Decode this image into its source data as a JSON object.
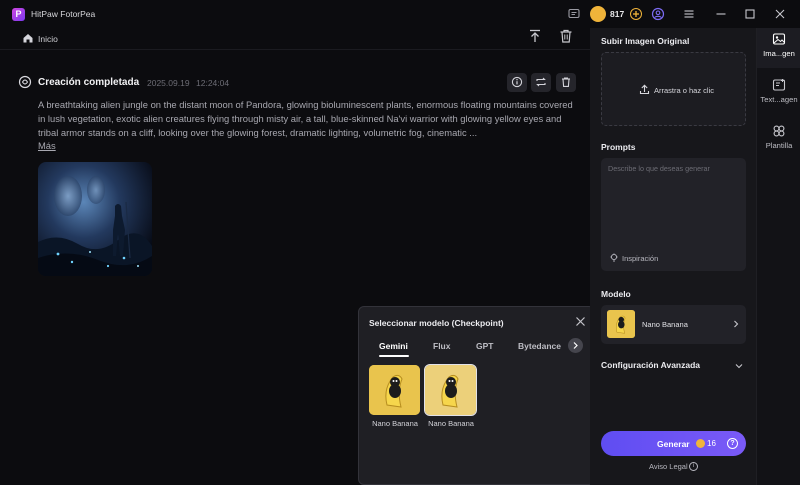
{
  "app": {
    "title": "HitPaw FotorPea",
    "coins": "817"
  },
  "header": {
    "home_label": "Inicio"
  },
  "task": {
    "title": "Creación completada",
    "date": "2025.09.19",
    "time": "12:24:04",
    "prompt": "A breathtaking alien jungle on the distant moon of Pandora, glowing bioluminescent plants, enormous floating mountains covered in lush vegetation, exotic alien creatures flying through misty air, a tall, blue-skinned Na'vi warrior with glowing yellow eyes and tribal armor stands on a cliff, looking over the glowing forest, dramatic lighting, volumetric fog, cinematic ...",
    "more_label": "Más"
  },
  "model_popup": {
    "title": "Seleccionar modelo (Checkpoint)",
    "tabs": [
      "Gemini",
      "Flux",
      "GPT",
      "Bytedance"
    ],
    "active_tab": "Gemini",
    "models": [
      {
        "name": "Nano Banana",
        "selected": false
      },
      {
        "name": "Nano Banana",
        "selected": true
      }
    ]
  },
  "right_panel": {
    "upload_title": "Subir Imagen Original",
    "upload_cta": "Arrastra o haz clic",
    "prompts_title": "Prompts",
    "prompt_placeholder": "Describe lo que deseas generar",
    "inspiration_label": "Inspiración",
    "model_title": "Modelo",
    "model_selected": "Nano Banana",
    "advanced_title": "Configuración Avanzada",
    "generate_label": "Generar",
    "generate_cost": "16",
    "legal_label": "Aviso Legal"
  },
  "side_nav": [
    {
      "label": "Ima...gen",
      "icon": "image-icon",
      "active": true
    },
    {
      "label": "Text...agen",
      "icon": "text-to-image-icon",
      "active": false
    },
    {
      "label": "Plantilla",
      "icon": "template-icon",
      "active": false
    }
  ],
  "colors": {
    "accent": "#6a52f5",
    "coin": "#f0b43a",
    "background": "#0c0c0f",
    "panel": "#17171b"
  }
}
